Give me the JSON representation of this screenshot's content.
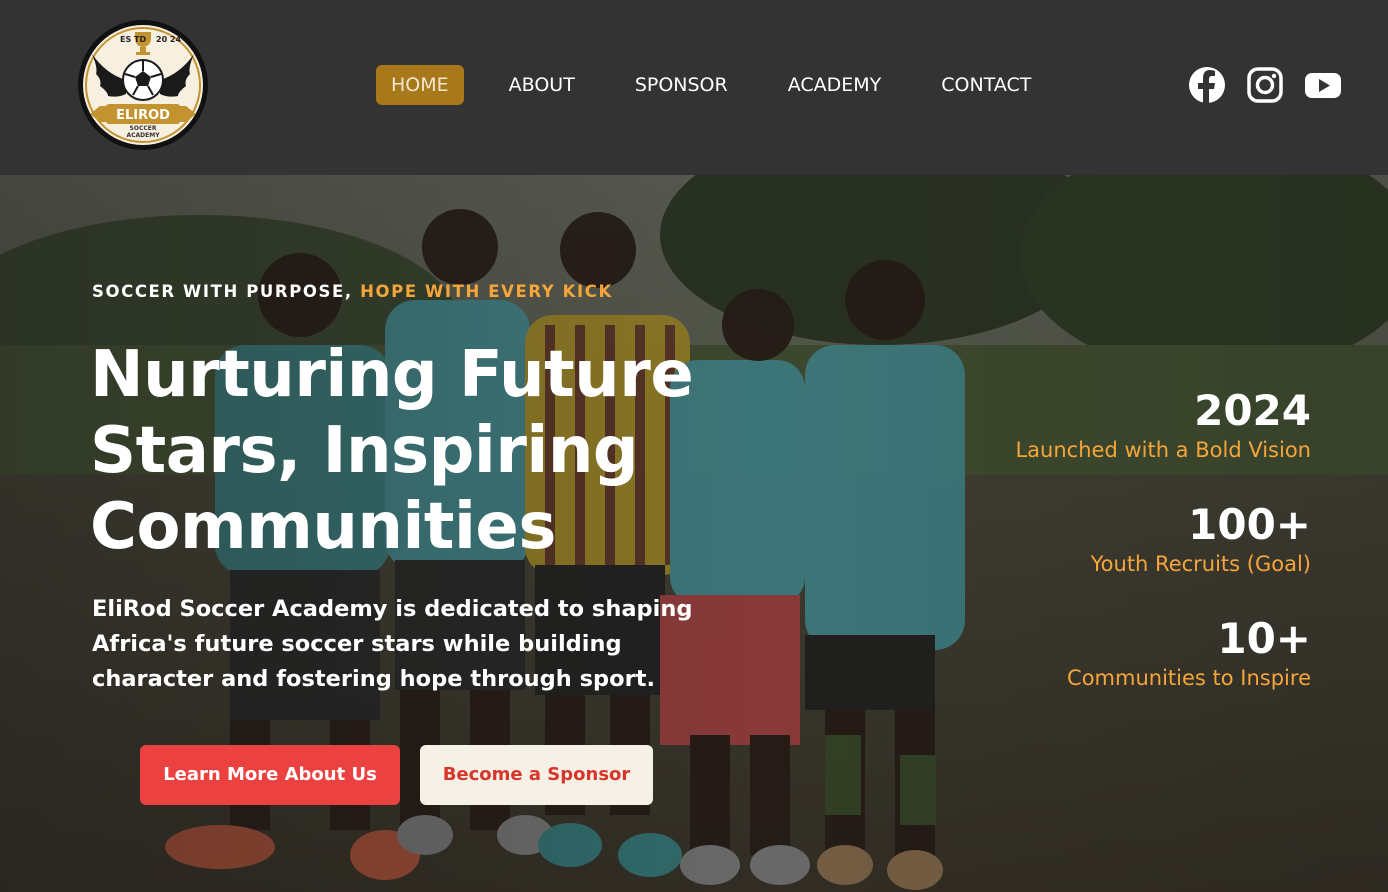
{
  "brand": {
    "logo_top": "ES TD",
    "logo_year": "20 24",
    "logo_name": "ELIROD",
    "logo_sub1": "SOCCER",
    "logo_sub2": "ACADEMY"
  },
  "nav": {
    "items": [
      {
        "label": "HOME",
        "active": true
      },
      {
        "label": "ABOUT",
        "active": false
      },
      {
        "label": "SPONSOR",
        "active": false
      },
      {
        "label": "ACADEMY",
        "active": false
      },
      {
        "label": "CONTACT",
        "active": false
      }
    ]
  },
  "socials": [
    {
      "icon": "facebook-icon"
    },
    {
      "icon": "instagram-icon"
    },
    {
      "icon": "youtube-icon"
    }
  ],
  "hero": {
    "tagline_white": "SOCCER WITH PURPOSE,",
    "tagline_accent": "HOPE WITH EVERY KICK",
    "headline": "Nurturing Future Stars, Inspiring Communities",
    "lead": "EliRod Soccer Academy is dedicated to shaping Africa's future soccer stars while building character and fostering hope through sport.",
    "primary_button": "Learn More About Us",
    "secondary_button": "Become a Sponsor"
  },
  "stats": [
    {
      "value": "2024",
      "label": "Launched with a Bold Vision"
    },
    {
      "value": "100+",
      "label": "Youth Recruits (Goal)"
    },
    {
      "value": "10+",
      "label": "Communities to Inspire"
    }
  ],
  "colors": {
    "header_bg": "#333333",
    "nav_active": "#a7791b",
    "accent": "#f5a53a",
    "primary_button": "#ec4141",
    "secondary_button": "#f6f1e6"
  }
}
